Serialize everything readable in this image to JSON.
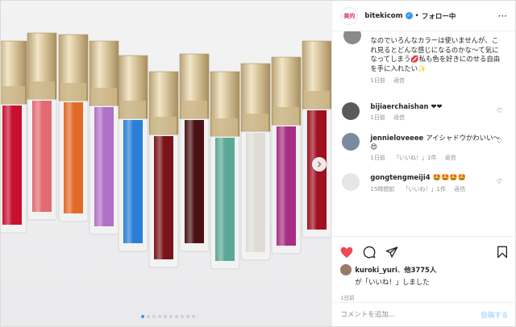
{
  "post": {
    "account": "bitekicom",
    "separator": "•",
    "follow_label": "フォロー中",
    "more_label": "···",
    "brand_logo_text": "美的"
  },
  "caption": {
    "text": "なのでいろんなカラーは使いませんが、これ見るとどんな感じになるのかな〜て気になってしまう💋私も色を好きにのせる自由を手に入れたい✨",
    "age": "1日前",
    "reply_label": "返信"
  },
  "comments": [
    {
      "user": "bijiaerchaishan",
      "text": "❤❤",
      "age": "1日前",
      "reply_label": "返信",
      "likes": "",
      "avatar_color": "#5a5a5a"
    },
    {
      "user": "jennieloveeee",
      "text": "アイシャドウかわいい〜😍",
      "age": "1日前",
      "likes": "「いいね！」1件",
      "reply_label": "返信",
      "avatar_color": "#7a8aa0"
    },
    {
      "user": "gongtengmeiji4",
      "text": "🤩🤩🤩🤩",
      "age": "15時間前",
      "likes": "「いいね！」1件",
      "reply_label": "返信",
      "avatar_color": "#e6e6e6"
    }
  ],
  "likes": {
    "liker": "kuroki_yuri",
    "others": "他3775人",
    "suffix": "が「いいね！」しました"
  },
  "post_age": "1日前",
  "add_comment": {
    "placeholder": "コメントを追加...",
    "post_label": "投稿する"
  },
  "carousel": {
    "slides": 10,
    "active": 0
  },
  "colors": {
    "like_red": "#ed4956",
    "verified_blue": "#3897f0",
    "post_button": "#b2dffc",
    "secondary_text": "#8e8e8e"
  },
  "tubes": [
    {
      "color": "#c8102e"
    },
    {
      "color": "#e36a72"
    },
    {
      "color": "#e26a28"
    },
    {
      "color": "#b070c8"
    },
    {
      "color": "#2a7ed8"
    },
    {
      "color": "#7a1418"
    },
    {
      "color": "#4a1214"
    },
    {
      "color": "#5aa896"
    },
    {
      "color": "#dedcd4"
    },
    {
      "color": "#a82e84"
    },
    {
      "color": "#a01020"
    }
  ]
}
